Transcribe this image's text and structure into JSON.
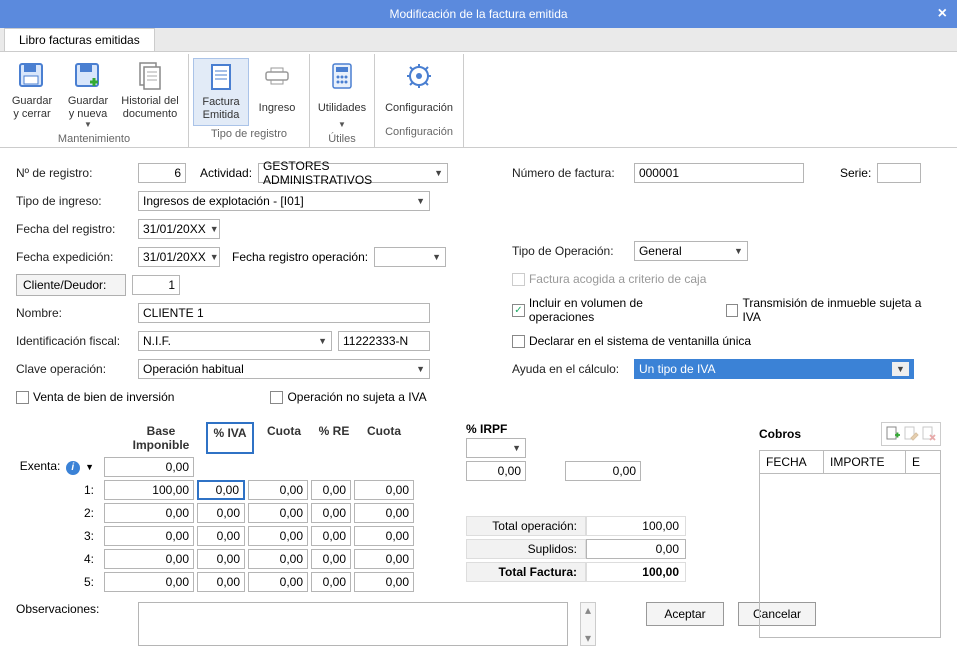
{
  "title": "Modificación de la factura emitida",
  "tab_label": "Libro facturas emitidas",
  "ribbon": {
    "groups": [
      {
        "title": "Mantenimiento",
        "items": [
          {
            "id": "guardar-cerrar",
            "label": "Guardar\ny cerrar",
            "caret": false
          },
          {
            "id": "guardar-nueva",
            "label": "Guardar\ny nueva",
            "caret": true
          },
          {
            "id": "historial",
            "label": "Historial del\ndocumento",
            "caret": false
          }
        ]
      },
      {
        "title": "Tipo de registro",
        "items": [
          {
            "id": "factura-emitida",
            "label": "Factura\nEmitida",
            "active": true
          },
          {
            "id": "ingreso",
            "label": "Ingreso"
          }
        ]
      },
      {
        "title": "Útiles",
        "items": [
          {
            "id": "utilidades",
            "label": "Utilidades",
            "caret": true
          }
        ]
      },
      {
        "title": "Configuración",
        "items": [
          {
            "id": "configuracion",
            "label": "Configuración"
          }
        ]
      }
    ]
  },
  "form": {
    "num_registro_lbl": "Nº de registro:",
    "num_registro": "6",
    "actividad_lbl": "Actividad:",
    "actividad": "GESTORES ADMINISTRATIVOS",
    "tipo_ingreso_lbl": "Tipo de ingreso:",
    "tipo_ingreso": "Ingresos de explotación - [I01]",
    "fecha_registro_lbl": "Fecha del registro:",
    "fecha_registro": "31/01/20XX",
    "fecha_exp_lbl": "Fecha expedición:",
    "fecha_exp": "31/01/20XX",
    "fecha_reg_op_lbl": "Fecha registro operación:",
    "fecha_reg_op": "",
    "cliente_btn": "Cliente/Deudor:",
    "cliente_id": "1",
    "nombre_lbl": "Nombre:",
    "nombre": "CLIENTE 1",
    "ident_fiscal_lbl": "Identificación fiscal:",
    "ident_fiscal_tipo": "N.I.F.",
    "ident_fiscal_num": "11222333-N",
    "clave_op_lbl": "Clave operación:",
    "clave_op": "Operación habitual",
    "venta_inversion_lbl": "Venta de bien de inversión",
    "op_no_iva_lbl": "Operación no sujeta a IVA",
    "num_factura_lbl": "Número de factura:",
    "num_factura": "000001",
    "serie_lbl": "Serie:",
    "serie": "",
    "tipo_operacion_lbl": "Tipo de Operación:",
    "tipo_operacion": "General",
    "factura_caja_lbl": "Factura acogida a criterio de caja",
    "incluir_vol_lbl": "Incluir en  volumen de operaciones",
    "transmision_lbl": "Transmisión de inmueble sujeta a IVA",
    "declarar_vent_lbl": "Declarar en el sistema de ventanilla única",
    "ayuda_calc_lbl": "Ayuda en el cálculo:",
    "ayuda_calc": "Un tipo de IVA"
  },
  "tax": {
    "header": {
      "bi": "Base Imponible",
      "iva": "% IVA",
      "cuota1": "Cuota",
      "re": "% RE",
      "cuota2": "Cuota",
      "irpf": "% IRPF"
    },
    "exenta_lbl": "Exenta:",
    "rows_lbls": [
      "1:",
      "2:",
      "3:",
      "4:",
      "5:"
    ],
    "exenta_bi": "0,00",
    "r1": {
      "bi": "100,00",
      "iva": "0,00",
      "c1": "0,00",
      "re": "0,00",
      "c2": "0,00"
    },
    "r2": {
      "bi": "0,00",
      "iva": "0,00",
      "c1": "0,00",
      "re": "0,00",
      "c2": "0,00"
    },
    "r3": {
      "bi": "0,00",
      "iva": "0,00",
      "c1": "0,00",
      "re": "0,00",
      "c2": "0,00"
    },
    "r4": {
      "bi": "0,00",
      "iva": "0,00",
      "c1": "0,00",
      "re": "0,00",
      "c2": "0,00"
    },
    "r5": {
      "bi": "0,00",
      "iva": "0,00",
      "c1": "0,00",
      "re": "0,00",
      "c2": "0,00"
    },
    "irpf_drop": "",
    "irpf_c1": "0,00",
    "irpf_c2": "0,00",
    "total_op_lbl": "Total operación:",
    "total_op": "100,00",
    "suplidos_lbl": "Suplidos:",
    "suplidos": "0,00",
    "total_fac_lbl": "Total Factura:",
    "total_fac": "100,00"
  },
  "cobros": {
    "title": "Cobros",
    "cols": {
      "fecha": "FECHA",
      "importe": "IMPORTE",
      "e": "E"
    }
  },
  "bottom": {
    "obs_lbl": "Observaciones:",
    "aceptar": "Aceptar",
    "cancelar": "Cancelar"
  }
}
